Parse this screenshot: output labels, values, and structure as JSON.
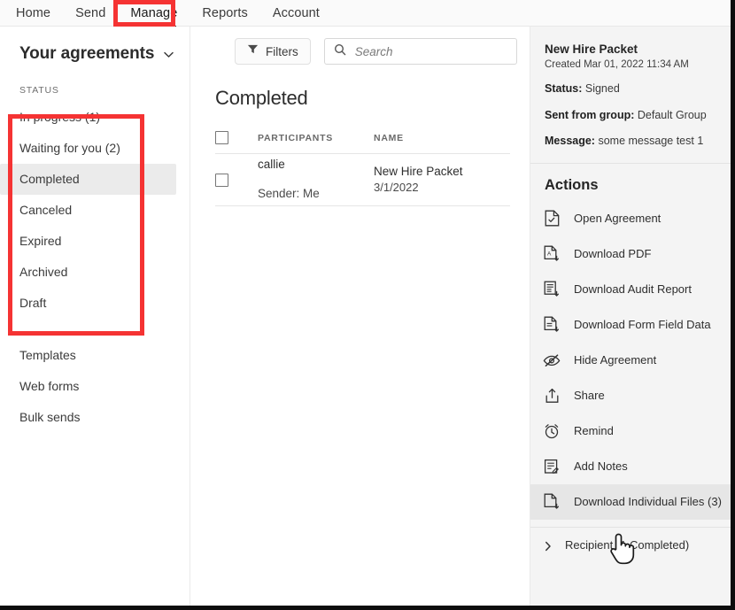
{
  "topnav": {
    "items": [
      {
        "label": "Home",
        "active": false
      },
      {
        "label": "Send",
        "active": false
      },
      {
        "label": "Manage",
        "active": true
      },
      {
        "label": "Reports",
        "active": false
      },
      {
        "label": "Account",
        "active": false
      }
    ]
  },
  "sidebar": {
    "title": "Your agreements",
    "chevron_icon": "chevron-down-icon",
    "status_label": "STATUS",
    "status_items": [
      {
        "label": "In progress (1)",
        "selected": false
      },
      {
        "label": "Waiting for you (2)",
        "selected": false
      },
      {
        "label": "Completed",
        "selected": true
      },
      {
        "label": "Canceled",
        "selected": false
      },
      {
        "label": "Expired",
        "selected": false
      },
      {
        "label": "Archived",
        "selected": false
      },
      {
        "label": "Draft",
        "selected": false
      }
    ],
    "nav_items": [
      {
        "label": "Templates"
      },
      {
        "label": "Web forms"
      },
      {
        "label": "Bulk sends"
      }
    ]
  },
  "toolbar": {
    "filters_label": "Filters",
    "filters_icon": "funnel-icon",
    "search_icon": "search-icon",
    "search_value": "",
    "search_placeholder": "Search"
  },
  "main": {
    "list_title": "Completed",
    "columns": {
      "participants": "PARTICIPANTS",
      "name": "NAME"
    },
    "rows": [
      {
        "participant": "callie",
        "sender": "Sender: Me",
        "name": "New Hire Packet",
        "date": "3/1/2022",
        "checked": false
      }
    ]
  },
  "detail": {
    "title": "New Hire Packet",
    "created": "Created Mar 01, 2022 11:34 AM",
    "fields": [
      {
        "label": "Status:",
        "value": "Signed"
      },
      {
        "label": "Sent from group:",
        "value": "Default Group"
      },
      {
        "label": "Message:",
        "value": "some message test 1"
      }
    ],
    "actions_title": "Actions",
    "actions": [
      {
        "label": "Open Agreement",
        "icon": "document-check-icon",
        "hover": false
      },
      {
        "label": "Download PDF",
        "icon": "pdf-download-icon",
        "hover": false
      },
      {
        "label": "Download Audit Report",
        "icon": "report-download-icon",
        "hover": false
      },
      {
        "label": "Download Form Field Data",
        "icon": "formdata-download-icon",
        "hover": false
      },
      {
        "label": "Hide Agreement",
        "icon": "eye-slash-icon",
        "hover": false
      },
      {
        "label": "Share",
        "icon": "share-upload-icon",
        "hover": false
      },
      {
        "label": "Remind",
        "icon": "alarm-clock-icon",
        "hover": false
      },
      {
        "label": "Add Notes",
        "icon": "notes-icon",
        "hover": false
      },
      {
        "label": "Download Individual Files (3)",
        "icon": "file-download-icon",
        "hover": true
      }
    ],
    "recipient_summary": "Recipient (1 Completed)",
    "recipient_chevron_icon": "chevron-right-icon"
  },
  "annotations": [
    {
      "name": "manage-tab-highlight",
      "color": "#f53333"
    },
    {
      "name": "status-list-highlight",
      "color": "#f53333"
    }
  ],
  "cursor": {
    "icon": "pointing-hand-cursor"
  }
}
